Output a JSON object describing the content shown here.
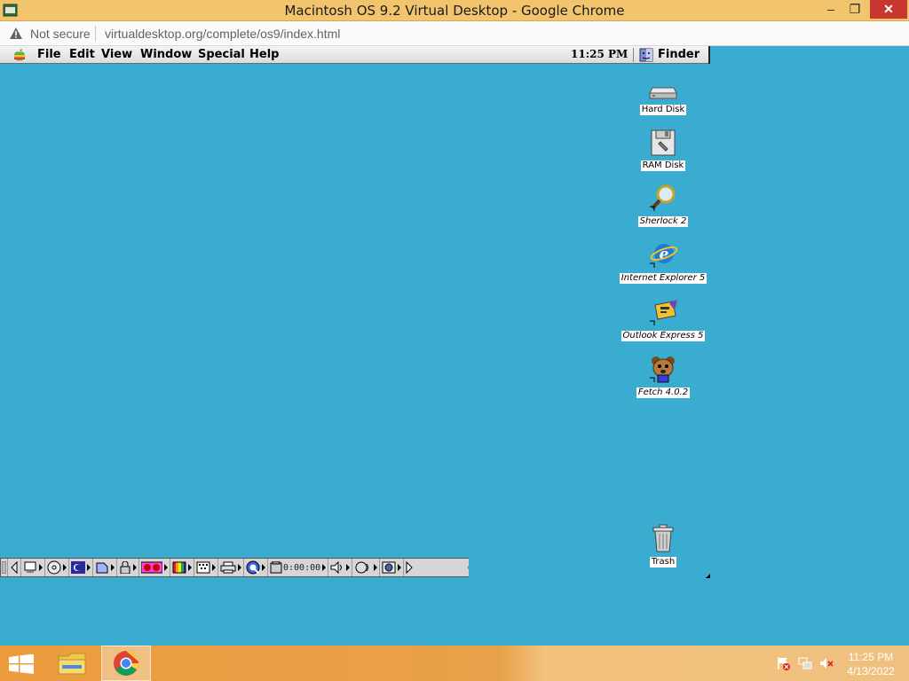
{
  "browser": {
    "title": "Macintosh OS 9.2 Virtual Desktop - Google Chrome",
    "security_label": "Not secure",
    "url": "virtualdesktop.org/complete/os9/index.html",
    "buttons": {
      "minimize": "–",
      "maximize": "❐",
      "close": "✕"
    }
  },
  "menubar": {
    "items": [
      "File",
      "Edit",
      "View",
      "Window",
      "Special",
      "Help"
    ],
    "clock": "11:25 PM",
    "app": "Finder"
  },
  "desktop_icons": [
    {
      "label": "Hard Disk",
      "icon": "hard-disk-icon",
      "alias": false
    },
    {
      "label": "RAM Disk",
      "icon": "ram-disk-icon",
      "alias": false
    },
    {
      "label": "Sherlock 2",
      "icon": "sherlock-icon",
      "alias": true
    },
    {
      "label": "Internet Explorer 5",
      "icon": "internet-explorer-icon",
      "alias": true
    },
    {
      "label": "Outlook Express 5",
      "icon": "outlook-express-icon",
      "alias": true
    },
    {
      "label": "Fetch 4.0.2",
      "icon": "fetch-icon",
      "alias": true
    },
    {
      "label": "Trash",
      "icon": "trash-icon",
      "alias": false
    }
  ],
  "control_strip": {
    "timer": "0:00:00"
  },
  "taskbar": {
    "time": "11:25 PM",
    "date": "4/13/2022"
  },
  "colors": {
    "desktop": "#3aaccf",
    "chrome_titlebar": "#f2c46d",
    "taskbar": "#ec9c3d"
  }
}
